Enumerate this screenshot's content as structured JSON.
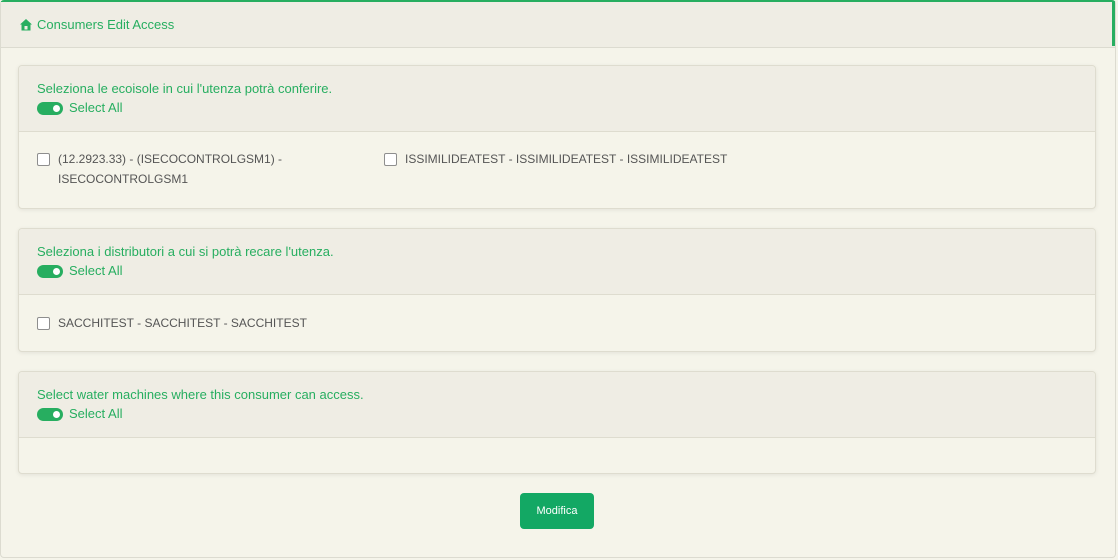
{
  "header": {
    "title": "Consumers Edit Access",
    "icon": "home-icon"
  },
  "colors": {
    "accent": "#27ae60",
    "button": "#13a864",
    "panel_bg": "#efede4",
    "page_bg": "#f5f4ea"
  },
  "sections": [
    {
      "heading": "Seleziona le ecoisole in cui l'utenza potrà conferire.",
      "select_all_label": "Select All",
      "select_all_on": true,
      "items": [
        {
          "line1": "(12.2923.33) - (ISECOCONTROLGSM1) -",
          "line2": "ISECOCONTROLGSM1",
          "checked": false
        },
        {
          "line1": "ISSIMILIDEATEST - ISSIMILIDEATEST - ISSIMILIDEATEST",
          "line2": "",
          "checked": false
        }
      ]
    },
    {
      "heading": "Seleziona i distributori a cui si potrà recare l'utenza.",
      "select_all_label": "Select All",
      "select_all_on": true,
      "items": [
        {
          "line1": "SACCHITEST - SACCHITEST - SACCHITEST",
          "line2": "",
          "checked": false
        }
      ]
    },
    {
      "heading": "Select water machines where this consumer can access.",
      "select_all_label": "Select All",
      "select_all_on": true,
      "items": []
    }
  ],
  "submit_label": "Modifica"
}
